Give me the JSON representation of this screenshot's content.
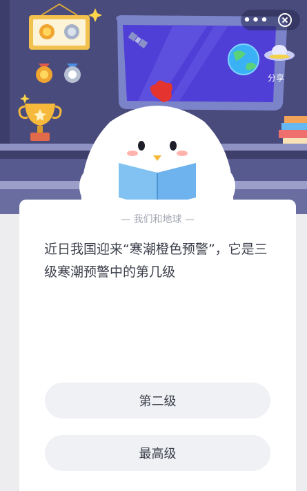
{
  "header": {
    "more_label": "•••",
    "share_label": "分享"
  },
  "card": {
    "subtitle": "— 我们和地球 —",
    "question": "近日我国迎来“寒潮橙色预警”，它是三级寒潮预警中的第几级"
  },
  "options": [
    {
      "label": "第二级"
    },
    {
      "label": "最高级"
    }
  ],
  "colors": {
    "scene_wall": "#494a7c",
    "window_space": "#4f3fd6",
    "card_bg": "#ffffff",
    "option_bg": "#eff1f5"
  }
}
